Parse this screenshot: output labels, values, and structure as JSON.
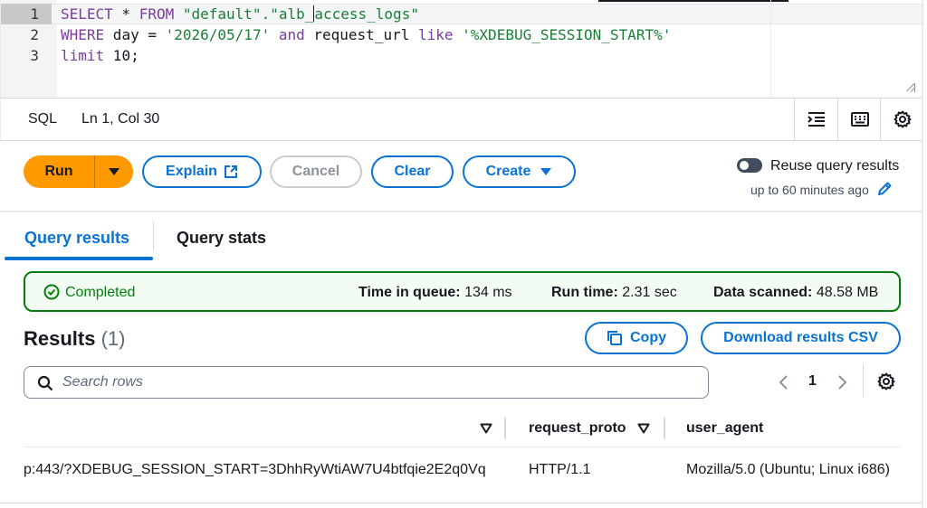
{
  "editor": {
    "line_numbers": [
      "1",
      "2",
      "3"
    ],
    "line1": {
      "p1": "SELECT",
      "p2": " * ",
      "p3": "FROM",
      "p4": " \"default\".\"alb_",
      "p5": "access_logs\""
    },
    "line2": {
      "p1": "WHERE",
      "p2": " day = ",
      "p3": "'2026/05/17'",
      "p4": " ",
      "p5": "and",
      "p6": " request_url ",
      "p7": "like",
      "p8": " ",
      "p9": "'%XDEBUG_SESSION_START%'"
    },
    "line3": {
      "p1": "limit",
      "p2": " 10;"
    }
  },
  "statusbar": {
    "language": "SQL",
    "position": "Ln 1, Col 30",
    "icons": [
      "format-icon",
      "keyboard-icon",
      "settings-icon"
    ]
  },
  "actions": {
    "run": "Run",
    "explain": "Explain",
    "cancel": "Cancel",
    "clear": "Clear",
    "create": "Create",
    "reuse_label": "Reuse query results",
    "reuse_sub": "up to 60 minutes ago"
  },
  "tabs": {
    "results": "Query results",
    "stats": "Query stats"
  },
  "banner": {
    "status": "Completed",
    "queue_label": "Time in queue:",
    "queue_value": "134 ms",
    "run_label": "Run time:",
    "run_value": "2.31 sec",
    "scanned_label": "Data scanned:",
    "scanned_value": "48.58 MB"
  },
  "results": {
    "title": "Results",
    "count": "(1)",
    "copy": "Copy",
    "download": "Download results CSV",
    "search_placeholder": "Search rows",
    "page": "1"
  },
  "table": {
    "columns": [
      "",
      "request_proto",
      "user_agent"
    ],
    "rows": [
      [
        "p:443/?XDEBUG_SESSION_START=3DhhRyWtiAW7U4btfqie2E2q0Vq",
        "HTTP/1.1",
        "Mozilla/5.0 (Ubuntu; Linux i686)"
      ]
    ]
  },
  "colors": {
    "accent": "#0972d3",
    "run": "#ff9900",
    "success": "#037f0c"
  }
}
